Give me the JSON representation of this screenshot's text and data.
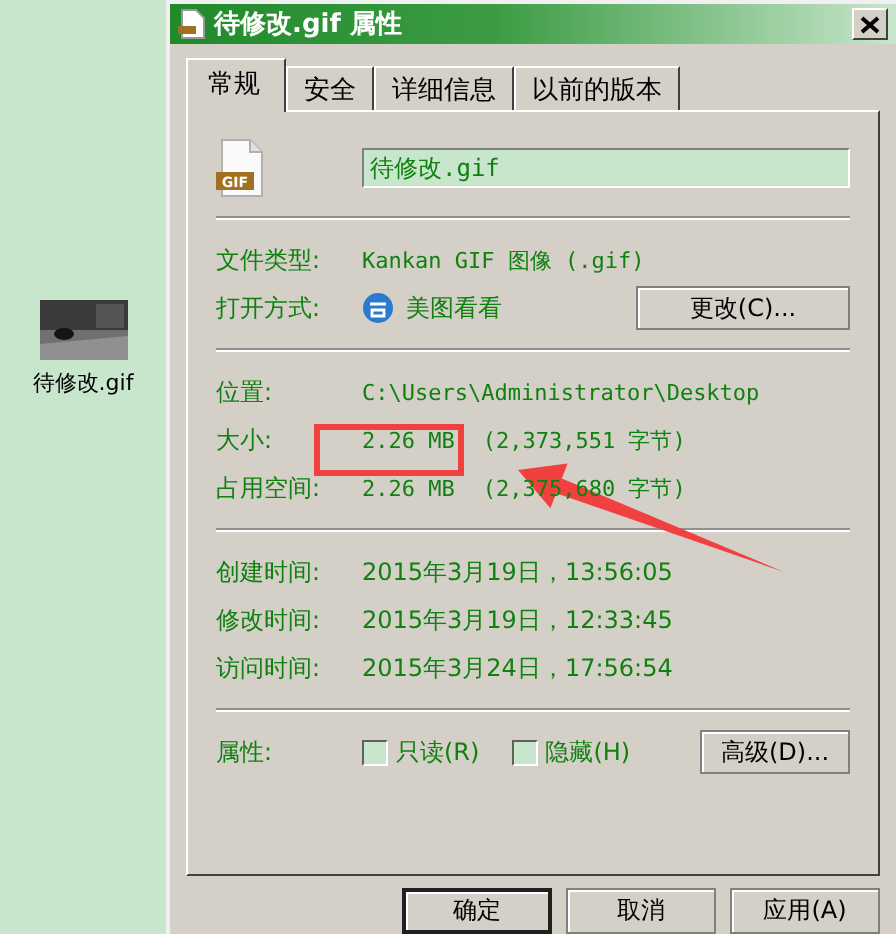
{
  "desktop_icon": {
    "label": "待修改.gif",
    "kind": "picture"
  },
  "window": {
    "title": "待修改.gif 属性"
  },
  "tabs": [
    {
      "label": "常规",
      "selected": true
    },
    {
      "label": "安全",
      "selected": false
    },
    {
      "label": "详细信息",
      "selected": false
    },
    {
      "label": "以前的版本",
      "selected": false
    }
  ],
  "file_name": {
    "badge": "GIF",
    "value": "待修改.gif"
  },
  "type_rows": [
    {
      "kind": "text",
      "label": "文件类型:",
      "value": "Kankan GIF 图像 (.gif)"
    },
    {
      "kind": "app",
      "label": "打开方式:",
      "value": "美图看看",
      "button": "更改(C)..."
    }
  ],
  "location_rows": [
    {
      "label": "位置:",
      "value": "C:\\Users\\Administrator\\Desktop"
    },
    {
      "label": "大小:",
      "value": "2.26 MB",
      "detail": "(2,373,551 字节)",
      "highlighted": true
    },
    {
      "label": "占用空间:",
      "value": "2.26 MB",
      "detail": "(2,375,680 字节)",
      "highlighted": false
    }
  ],
  "time_rows": [
    {
      "label": "创建时间:",
      "value": "2015年3月19日，13:56:05"
    },
    {
      "label": "修改时间:",
      "value": "2015年3月19日，12:33:45"
    },
    {
      "label": "访问时间:",
      "value": "2015年3月24日，17:56:54"
    }
  ],
  "attributes": {
    "label": "属性:",
    "options": [
      {
        "label": "只读(R)",
        "checked": false
      },
      {
        "label": "隐藏(H)",
        "checked": false
      }
    ],
    "button": "高级(D)..."
  },
  "buttons": [
    {
      "label": "确定",
      "default": true
    },
    {
      "label": "取消",
      "default": false
    },
    {
      "label": "应用(A)",
      "default": false
    }
  ]
}
